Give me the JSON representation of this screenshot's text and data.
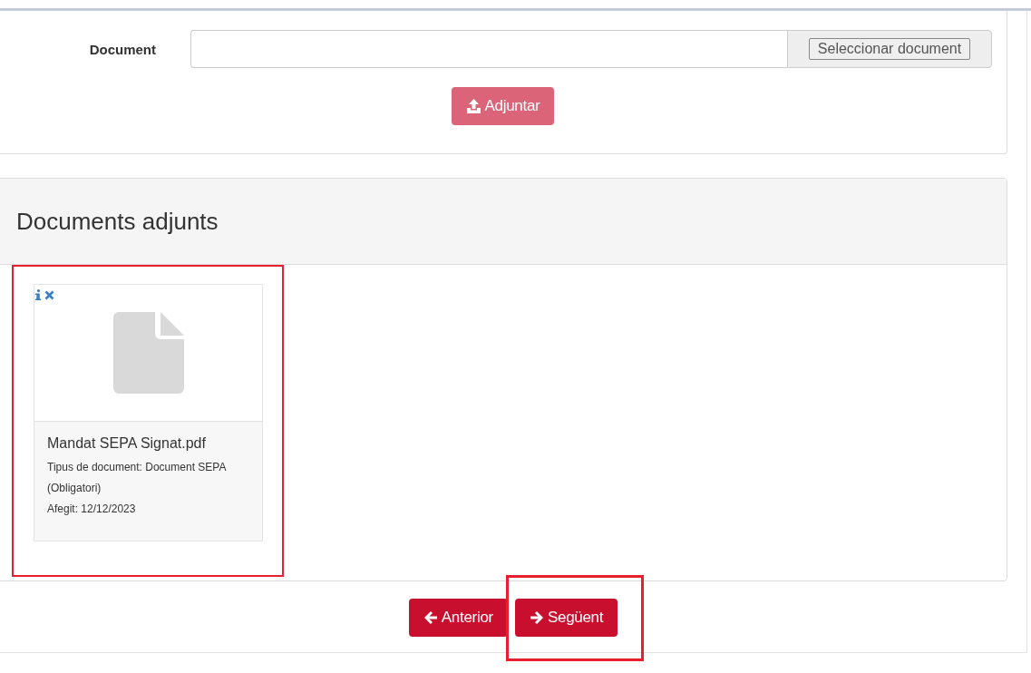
{
  "upload_form": {
    "label": "Document",
    "file_button": "Seleccionar document",
    "attach_button": {
      "label": "Adjuntar",
      "disabled": true
    }
  },
  "attachments": {
    "title": "Documents adjunts",
    "documents": [
      {
        "name": "Mandat SEPA Signat.pdf",
        "type_line": "Tipus de document: Document SEPA (Obligatori)",
        "added": "Afegit: 12/12/2023",
        "highlighted": true
      }
    ]
  },
  "navigation": [
    {
      "kind": "back",
      "label": "Anterior",
      "highlighted": false
    },
    {
      "kind": "next",
      "label": "Següent",
      "highlighted": true
    }
  ]
}
